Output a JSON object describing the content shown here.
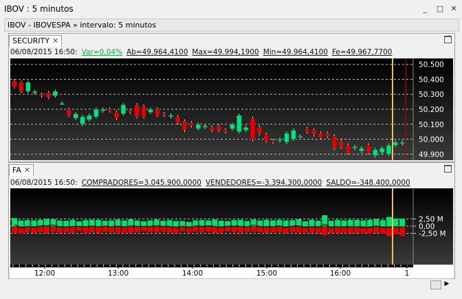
{
  "window": {
    "title": "IBOV : 5 minutos",
    "minimize": "_",
    "maximize": "□",
    "close": "✕"
  },
  "breadcrumb": "IBOV - IBOVESPA » intervalo: 5 minutos",
  "security_panel": {
    "tab_label": "SECURITY",
    "tab_close": "✕",
    "info": {
      "datetime": "06/08/2015 16:50:",
      "var": "Var=0,04%",
      "ab": "Ab=49.964,4100",
      "max": "Max=49.994,1900",
      "min": "Min=49.964,4100",
      "fe": "Fe=49.967,7700"
    },
    "y_ticks": [
      "50.500",
      "50.400",
      "50.300",
      "50.200",
      "50.100",
      "50.000",
      "49.900"
    ],
    "colors": {
      "up": "#00e080",
      "down": "#e00000",
      "cursor": "#f0c060"
    }
  },
  "fa_panel": {
    "tab_label": "FA",
    "tab_close": "✕",
    "info": {
      "datetime": "06/08/2015 16:50:",
      "compradores": "COMPRADORES=3.045.900,0000",
      "vendedores": "VENDEDORES=-3.394.300,0000",
      "saldo": "SALDO=-348.400,0000"
    },
    "y_ticks": [
      "2,50 M",
      "0,00",
      "-2,50 M"
    ],
    "x_ticks": [
      "12:00",
      "13:00",
      "14:00",
      "15:00",
      "16:00",
      "1"
    ]
  },
  "chart_data": [
    {
      "type": "candlestick",
      "series": [
        {
          "open": [
            50390,
            50380,
            50320,
            50310,
            50300,
            50310,
            50290,
            50240,
            50200,
            50140,
            50100,
            50130,
            50150,
            50190,
            50200,
            50180,
            50170,
            50190,
            50230,
            50220,
            50180,
            50200,
            50170,
            50150,
            50150,
            50120,
            50110,
            50070,
            50080,
            50080,
            50090,
            50060,
            50070,
            50050,
            50060,
            50140,
            50080,
            50030,
            49990,
            49990,
            49980,
            50000,
            50020,
            50070,
            50060,
            50040,
            50040,
            50020,
            49990,
            49960,
            49940,
            49920,
            49960,
            49890,
            49910,
            49900,
            49960,
            49970
          ],
          "close": [
            50350,
            50320,
            50380,
            50320,
            50290,
            50280,
            50320,
            50240,
            50160,
            50170,
            50150,
            50160,
            50200,
            50200,
            50190,
            50140,
            50230,
            50180,
            50150,
            50150,
            50200,
            50160,
            50160,
            50160,
            50110,
            50060,
            50090,
            50100,
            50090,
            50060,
            50060,
            50050,
            50100,
            50160,
            50080,
            50000,
            50040,
            49990,
            49980,
            50000,
            50040,
            50060,
            50020,
            50050,
            50030,
            50010,
            50020,
            49940,
            49950,
            49910,
            49950,
            49940,
            49910,
            49930,
            49940,
            49960,
            49980,
            49980
          ]
        }
      ]
    },
    {
      "type": "bar",
      "series": [
        {
          "name": "COMPRADORES",
          "values": [
            2.8,
            2.0,
            2.1,
            2.0,
            2.2,
            2.5,
            2.4,
            2.0,
            1.9,
            2.2,
            1.7,
            2.1,
            2.2,
            2.2,
            1.9,
            2.0,
            2.3,
            2.0,
            2.4,
            2.0,
            1.7,
            2.0,
            2.3,
            1.9,
            2.1,
            1.8,
            1.8,
            1.5,
            2.0,
            2.1,
            2.0,
            2.3,
            1.9,
            1.8,
            2.1,
            2.2,
            1.8,
            2.3,
            2.0,
            2.2,
            2.0,
            2.2,
            2.0,
            2.1,
            2.4,
            1.7,
            2.2,
            1.9,
            3.8,
            1.9,
            2.2,
            2.0,
            2.2,
            2.2,
            2.0,
            2.2,
            2.5,
            2.1,
            3.2,
            2.6,
            2.6
          ]
        },
        {
          "name": "VENDEDORES",
          "values": [
            -2.3,
            -2.6,
            -2.2,
            -2.4,
            -2.1,
            -2.4,
            -2.0,
            -2.3,
            -2.2,
            -2.3,
            -1.8,
            -2.3,
            -2.2,
            -2.4,
            -1.9,
            -2.2,
            -2.3,
            -2.3,
            -2.3,
            -2.1,
            -1.8,
            -2.1,
            -2.2,
            -2.0,
            -2.2,
            -2.5,
            -1.8,
            -2.2,
            -1.9,
            -2.2,
            -1.9,
            -2.4,
            -2.3,
            -1.8,
            -2.1,
            -2.3,
            -2.1,
            -1.9,
            -2.1,
            -2.4,
            -2.2,
            -2.1,
            -2.5,
            -2.1,
            -2.3,
            -2.2,
            -2.3,
            -2.3,
            -3.2,
            -2.4,
            -2.4,
            -2.3,
            -2.4,
            -2.4,
            -2.5,
            -2.7,
            -2.4,
            -2.6,
            -3.6,
            -2.8,
            -3.4
          ]
        },
        {
          "name": "SALDO",
          "values": [
            0.5,
            -0.6,
            -0.1,
            -0.4,
            0.1,
            0.1,
            0.4,
            -0.3,
            -0.3,
            -0.1,
            -0.1,
            -0.2,
            0.0,
            -0.2,
            0.0,
            -0.2,
            0.0,
            -0.3,
            0.1,
            -0.1,
            -0.1,
            -0.1,
            0.1,
            -0.1,
            -0.1,
            -0.7,
            0.0,
            -0.7,
            0.1,
            -0.1,
            0.1,
            -0.1,
            -0.4,
            0.0,
            0.0,
            -0.1,
            -0.3,
            0.4,
            -0.1,
            -0.2,
            -0.2,
            0.1,
            -0.5,
            0.0,
            0.1,
            -0.5,
            -0.1,
            -0.4,
            0.6,
            -0.5,
            -0.2,
            -0.3,
            -0.2,
            -0.2,
            -0.5,
            -0.5,
            0.1,
            -0.5,
            -0.4,
            -0.2,
            -0.3
          ]
        }
      ]
    }
  ]
}
